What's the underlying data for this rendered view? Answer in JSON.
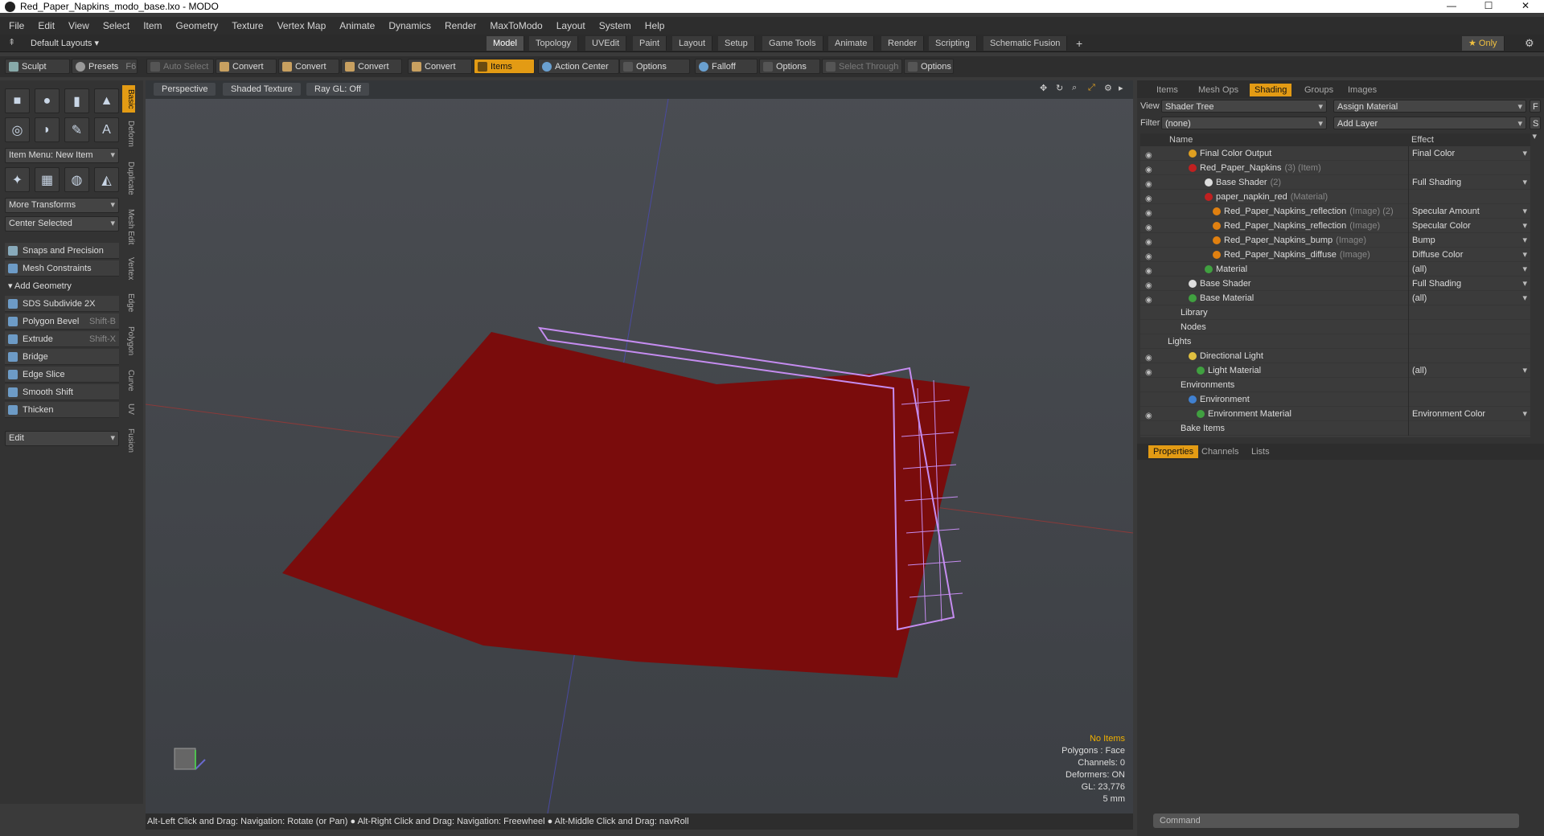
{
  "window": {
    "title": "Red_Paper_Napkins_modo_base.lxo - MODO",
    "controls": [
      "—",
      "☐",
      "✕"
    ]
  },
  "menu": [
    "File",
    "Edit",
    "View",
    "Select",
    "Item",
    "Geometry",
    "Texture",
    "Vertex Map",
    "Animate",
    "Dynamics",
    "Render",
    "MaxToModo",
    "Layout",
    "System",
    "Help"
  ],
  "layoutbar": {
    "layouts": "Default Layouts",
    "tabs": [
      "Model",
      "Topology",
      "UVEdit",
      "Paint",
      "Layout",
      "Setup",
      "Game Tools",
      "Animate",
      "Render",
      "Scripting",
      "Schematic Fusion"
    ],
    "active_tab": "Model",
    "plus": "+",
    "only": "★  Only"
  },
  "toolbar": {
    "sculpt": "Sculpt",
    "presets": "Presets",
    "presets_key": "F6",
    "auto_select": "Auto Select",
    "convert": "Convert",
    "items": "Items",
    "action_center": "Action Center",
    "options": "Options",
    "falloff": "Falloff",
    "select_through": "Select Through"
  },
  "left": {
    "item_menu": "Item Menu: New Item",
    "more_transforms": "More Transforms",
    "center_selected": "Center Selected",
    "snaps": "Snaps and Precision",
    "mesh_constraints": "Mesh Constraints",
    "add_geometry": "Add Geometry",
    "tools": [
      {
        "label": "SDS Subdivide 2X",
        "shortcut": ""
      },
      {
        "label": "Polygon Bevel",
        "shortcut": "Shift-B"
      },
      {
        "label": "Extrude",
        "shortcut": "Shift-X"
      },
      {
        "label": "Bridge",
        "shortcut": ""
      },
      {
        "label": "Edge Slice",
        "shortcut": ""
      },
      {
        "label": "Smooth Shift",
        "shortcut": ""
      },
      {
        "label": "Thicken",
        "shortcut": ""
      }
    ],
    "edit": "Edit",
    "vtabs": [
      "Basic",
      "Deform",
      "Duplicate",
      "Mesh Edit",
      "Vertex",
      "Edge",
      "Polygon",
      "Curve",
      "UV",
      "Fusion"
    ]
  },
  "viewport": {
    "perspective": "Perspective",
    "shading": "Shaded Texture",
    "raygl": "Ray GL: Off",
    "stats": {
      "no_items": "No Items",
      "polygons": "Polygons : Face",
      "channels": "Channels: 0",
      "deformers": "Deformers: ON",
      "gl": "GL: 23,776",
      "scale": "5 mm"
    },
    "napkin_color": "#7a0c0c",
    "wire_color": "#c58cf0"
  },
  "status": "Alt-Left Click and Drag: Navigation: Rotate (or Pan) ● Alt-Right Click and Drag: Navigation: Freewheel ● Alt-Middle Click and Drag: navRoll",
  "right": {
    "tabs": [
      "Items",
      "Mesh Ops",
      "Shading",
      "Groups",
      "Images"
    ],
    "active_tab": "Shading",
    "view_label": "View",
    "view_value": "Shader Tree",
    "assign_material": "Assign Material",
    "filter_label": "Filter",
    "filter_value": "(none)",
    "add_layer": "Add Layer",
    "f_btn": "F",
    "s_btn": "S",
    "col_name": "Name",
    "col_effect": "Effect",
    "rows": [
      {
        "name": "Final Color Output",
        "type": "",
        "effect": "Final Color"
      },
      {
        "name": "Red_Paper_Napkins",
        "type": "(3) (Item)",
        "effect": ""
      },
      {
        "name": "Base Shader",
        "type": "(2)",
        "effect": "Full Shading"
      },
      {
        "name": "paper_napkin_red",
        "type": "(Material)",
        "effect": ""
      },
      {
        "name": "Red_Paper_Napkins_reflection",
        "type": "(Image) (2)",
        "effect": "Specular Amount"
      },
      {
        "name": "Red_Paper_Napkins_reflection",
        "type": "(Image)",
        "effect": "Specular Color"
      },
      {
        "name": "Red_Paper_Napkins_bump",
        "type": "(Image)",
        "effect": "Bump"
      },
      {
        "name": "Red_Paper_Napkins_diffuse",
        "type": "(Image)",
        "effect": "Diffuse Color"
      },
      {
        "name": "Material",
        "type": "",
        "effect": "(all)"
      },
      {
        "name": "Base Shader",
        "type": "",
        "effect": "Full Shading"
      },
      {
        "name": "Base Material",
        "type": "",
        "effect": "(all)"
      },
      {
        "name": "Library",
        "type": "",
        "effect": ""
      },
      {
        "name": "Nodes",
        "type": "",
        "effect": ""
      },
      {
        "name": "Lights",
        "type": "",
        "effect": ""
      },
      {
        "name": "Directional Light",
        "type": "",
        "effect": ""
      },
      {
        "name": "Light Material",
        "type": "",
        "effect": "(all)"
      },
      {
        "name": "Environments",
        "type": "",
        "effect": ""
      },
      {
        "name": "Environment",
        "type": "",
        "effect": ""
      },
      {
        "name": "Environment Material",
        "type": "",
        "effect": "Environment Color"
      },
      {
        "name": "Bake Items",
        "type": "",
        "effect": ""
      }
    ],
    "ptabs": [
      "Properties",
      "Channels",
      "Lists"
    ],
    "command_placeholder": "Command"
  }
}
